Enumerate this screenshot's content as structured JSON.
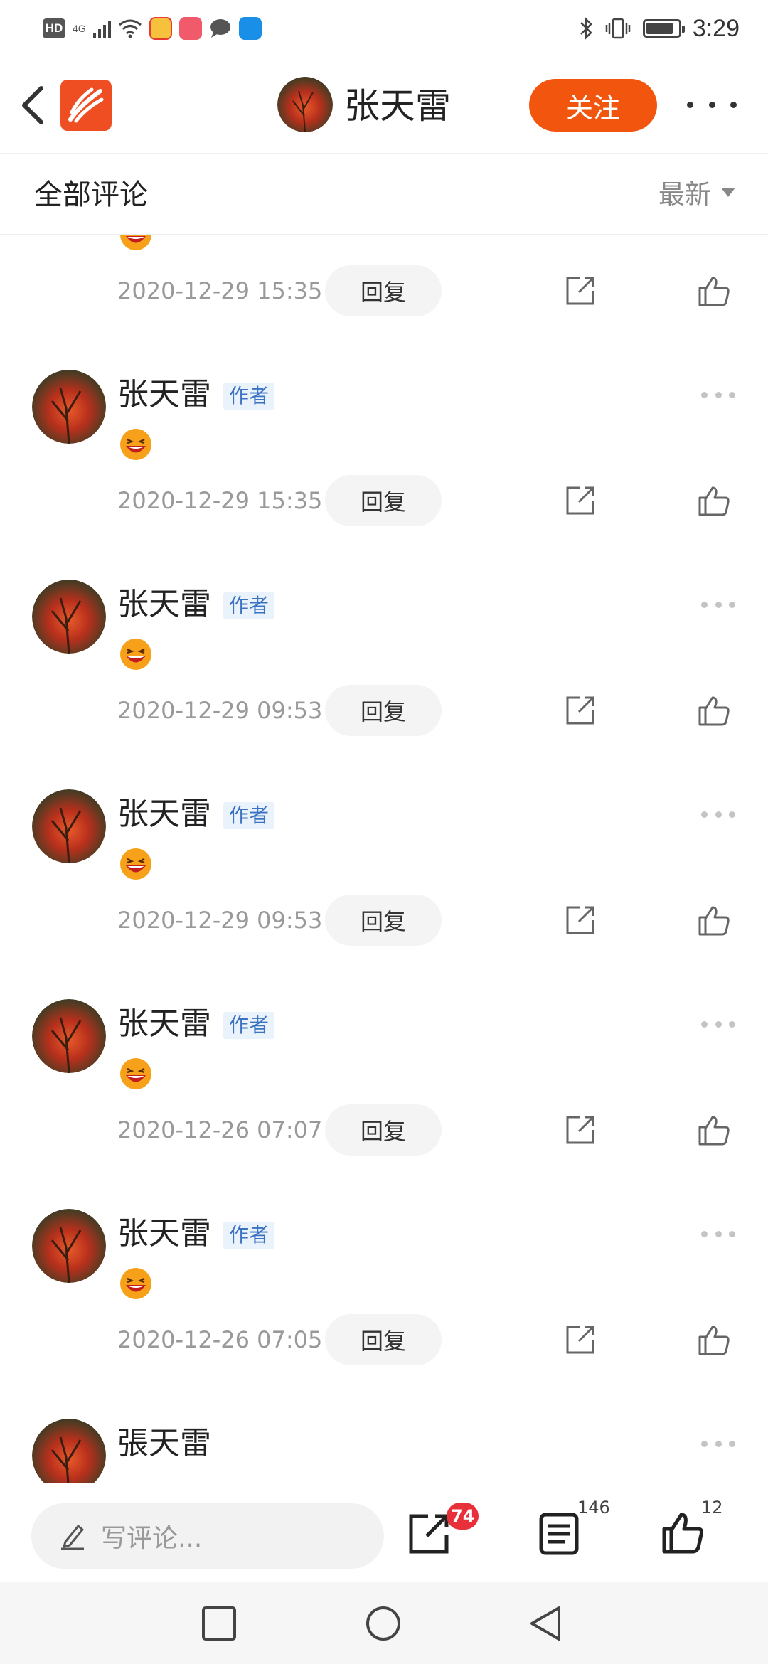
{
  "status_bar": {
    "hd": "HD",
    "network": "4G",
    "time": "3:29",
    "battery_level": 0.85
  },
  "header": {
    "author_name": "张天雷",
    "follow_label": "关注"
  },
  "comments_section": {
    "title": "全部评论",
    "sort_label": "最新"
  },
  "comments": [
    {
      "name": "",
      "badge": "",
      "time": "2020-12-29 15:35",
      "reply_label": "回复"
    },
    {
      "name": "张天雷",
      "badge": "作者",
      "time": "2020-12-29 15:35",
      "reply_label": "回复"
    },
    {
      "name": "张天雷",
      "badge": "作者",
      "time": "2020-12-29 09:53",
      "reply_label": "回复"
    },
    {
      "name": "张天雷",
      "badge": "作者",
      "time": "2020-12-29 09:53",
      "reply_label": "回复"
    },
    {
      "name": "张天雷",
      "badge": "作者",
      "time": "2020-12-26 07:07",
      "reply_label": "回复"
    },
    {
      "name": "张天雷",
      "badge": "作者",
      "time": "2020-12-26 07:05",
      "reply_label": "回复"
    },
    {
      "name": "張天雷",
      "badge": "",
      "time": "",
      "reply_label": ""
    }
  ],
  "bottom_bar": {
    "input_placeholder": "写评论...",
    "share_badge": "74",
    "comment_count": "146",
    "like_count": "12"
  },
  "colors": {
    "accent": "#f2550d",
    "badge_bg": "#eaf2fb",
    "badge_text": "#3b73c2",
    "notification": "#e8303a"
  },
  "icons": [
    "back-icon",
    "app-logo-icon",
    "more-icon",
    "sort-caret-icon",
    "laugh-emoji-icon",
    "share-icon",
    "thumbs-up-icon",
    "pencil-icon",
    "article-icon",
    "square-nav-icon",
    "circle-nav-icon",
    "triangle-nav-icon"
  ]
}
